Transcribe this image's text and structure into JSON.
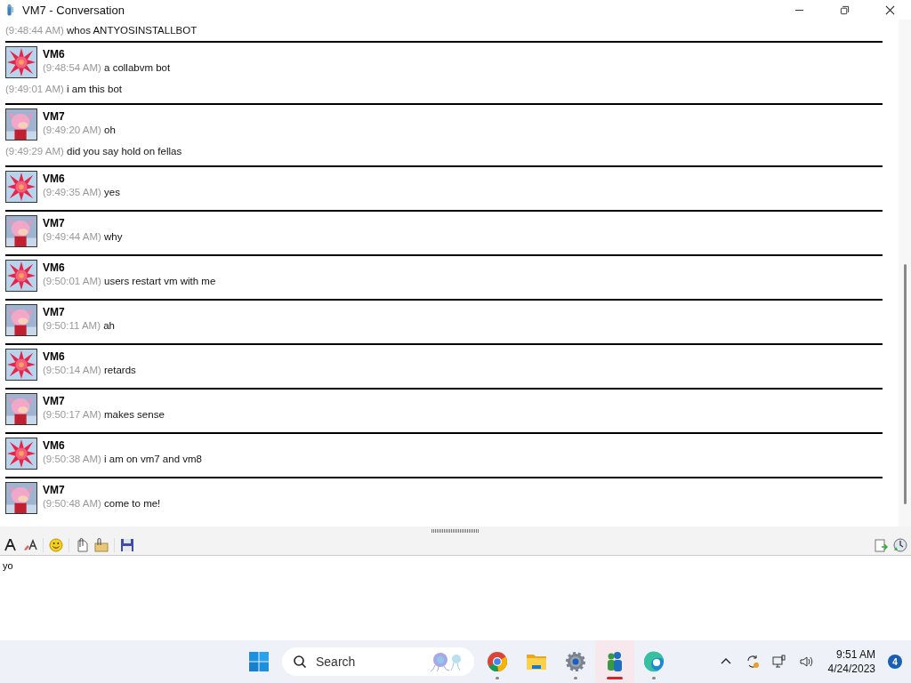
{
  "window": {
    "title": "VM7 - Conversation"
  },
  "conversation": {
    "partial_line": {
      "time": "(9:48:44 AM)",
      "text": "whos ANTYOSINSTALLBOT"
    },
    "groups": [
      {
        "sender": "VM6",
        "kind": "star",
        "lines": [
          {
            "time": "(9:48:54 AM)",
            "text": "a collabvm bot"
          },
          {
            "time": "(9:49:01 AM)",
            "text": "i am this bot"
          }
        ]
      },
      {
        "sender": "VM7",
        "kind": "pink",
        "lines": [
          {
            "time": "(9:49:20 AM)",
            "text": "oh"
          },
          {
            "time": "(9:49:29 AM)",
            "text": "did you say hold on fellas"
          }
        ]
      },
      {
        "sender": "VM6",
        "kind": "star",
        "lines": [
          {
            "time": "(9:49:35 AM)",
            "text": "yes"
          }
        ]
      },
      {
        "sender": "VM7",
        "kind": "pink",
        "lines": [
          {
            "time": "(9:49:44 AM)",
            "text": "why"
          }
        ]
      },
      {
        "sender": "VM6",
        "kind": "star",
        "lines": [
          {
            "time": "(9:50:01 AM)",
            "text": "users restart vm with me"
          }
        ]
      },
      {
        "sender": "VM7",
        "kind": "pink",
        "lines": [
          {
            "time": "(9:50:11 AM)",
            "text": "ah"
          }
        ]
      },
      {
        "sender": "VM6",
        "kind": "star",
        "lines": [
          {
            "time": "(9:50:14 AM)",
            "text": "retards"
          }
        ]
      },
      {
        "sender": "VM7",
        "kind": "pink",
        "lines": [
          {
            "time": "(9:50:17 AM)",
            "text": "makes sense"
          }
        ]
      },
      {
        "sender": "VM6",
        "kind": "star",
        "lines": [
          {
            "time": "(9:50:38 AM)",
            "text": "i am on vm7 and vm8"
          }
        ]
      },
      {
        "sender": "VM7",
        "kind": "pink",
        "lines": [
          {
            "time": "(9:50:48 AM)",
            "text": "come to me!"
          }
        ]
      }
    ]
  },
  "input": {
    "value": "yo"
  },
  "taskbar": {
    "search": {
      "placeholder": "Search"
    },
    "apps": [
      {
        "kind": "chrome",
        "open": true,
        "selected": false
      },
      {
        "kind": "folder",
        "open": false,
        "selected": false
      },
      {
        "kind": "settings",
        "open": true,
        "selected": false
      },
      {
        "kind": "messenger",
        "open": true,
        "selected": true
      },
      {
        "kind": "edge",
        "open": true,
        "selected": false
      }
    ],
    "time": "9:51 AM",
    "date": "4/24/2023",
    "notification_count": "4"
  }
}
